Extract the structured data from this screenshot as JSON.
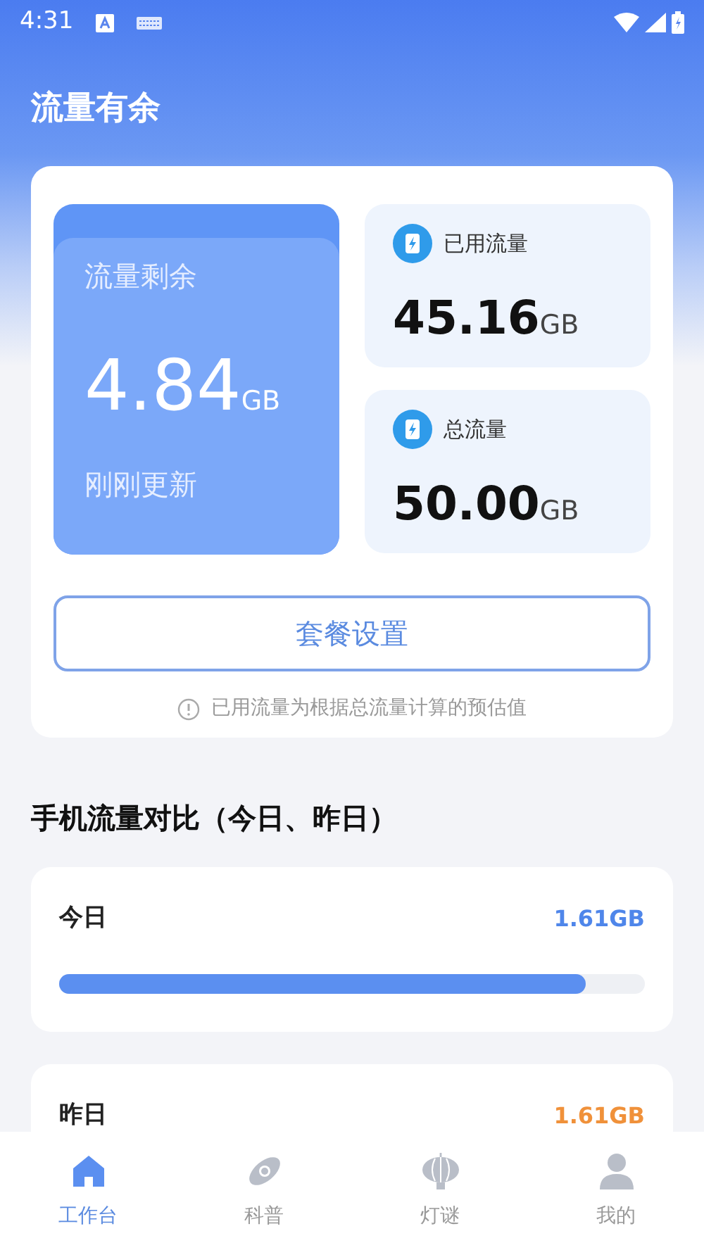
{
  "status_bar": {
    "time": "4:31"
  },
  "header": {
    "title": "流量有余"
  },
  "summary": {
    "remaining": {
      "label": "流量剩余",
      "value": "4.84",
      "unit": "GB",
      "note": "刚刚更新"
    },
    "stats": [
      {
        "label": "已用流量",
        "value": "45.16",
        "unit": "GB"
      },
      {
        "label": "总流量",
        "value": "50.00",
        "unit": "GB"
      }
    ],
    "button": "套餐设置",
    "hint": "已用流量为根据总流量计算的预估值"
  },
  "comparison": {
    "title": "手机流量对比（今日、昨日）",
    "days": [
      {
        "label": "今日",
        "value": "1.61GB",
        "color": "#4f86ea",
        "level": 0.9
      },
      {
        "label": "昨日",
        "value": "1.61GB",
        "color": "#f0913a"
      }
    ]
  },
  "tab_bar": [
    {
      "label": "工作台",
      "kind": "home",
      "selected": true
    },
    {
      "label": "科普",
      "kind": "planet",
      "selected": false
    },
    {
      "label": "灯谜",
      "kind": "lantern",
      "selected": false
    },
    {
      "label": "我的",
      "kind": "person",
      "selected": false
    }
  ]
}
